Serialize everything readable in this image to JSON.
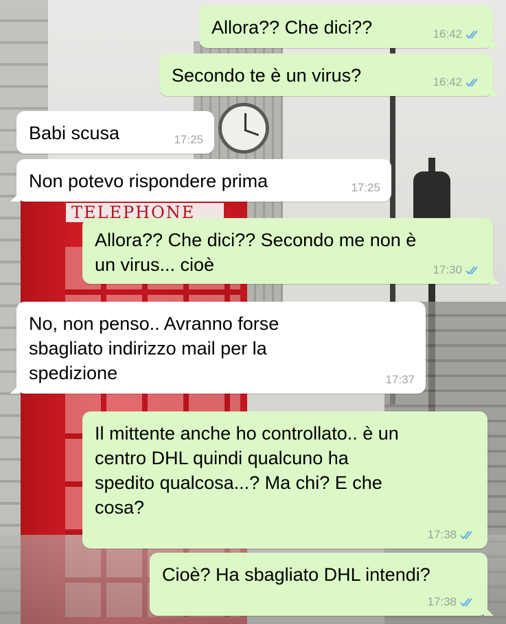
{
  "colors": {
    "outgoing_bubble": "#dcf8c6",
    "incoming_bubble": "#ffffff",
    "read_ticks": "#4fa6e4",
    "timestamp": "#9aa39a"
  },
  "background": {
    "booth_sign": "TELEPHONE"
  },
  "messages": [
    {
      "direction": "out",
      "text": "Allora?? Che dici??",
      "time": "16:42",
      "status_icon": "double-check-read-icon"
    },
    {
      "direction": "out",
      "text": "Secondo te è un virus?",
      "time": "16:42",
      "status_icon": "double-check-read-icon"
    },
    {
      "direction": "in",
      "text": "Babi scusa",
      "time": "17:25"
    },
    {
      "direction": "in",
      "text": "Non potevo rispondere prima",
      "time": "17:25"
    },
    {
      "direction": "out",
      "text": "Allora?? Che dici?? Secondo me non è\nun virus... cioè",
      "time": "17:30",
      "status_icon": "double-check-read-icon"
    },
    {
      "direction": "in",
      "text": "No, non penso.. Avranno forse\nsbagliato indirizzo mail per la\nspedizione",
      "time": "17:37"
    },
    {
      "direction": "out",
      "text": "Il mittente anche ho controllato.. è un\ncentro DHL quindi qualcuno ha\nspedito qualcosa...? Ma chi? E che\ncosa?",
      "time": "17:38",
      "status_icon": "double-check-read-icon"
    },
    {
      "direction": "out",
      "text": "Cioè? Ha sbagliato DHL intendi?",
      "time": "17:38",
      "status_icon": "double-check-read-icon"
    }
  ]
}
